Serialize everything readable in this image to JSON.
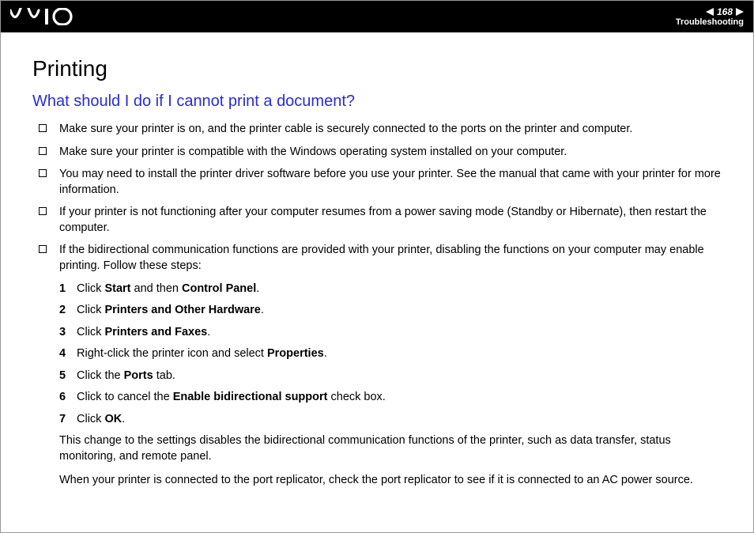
{
  "header": {
    "page_number": "168",
    "section": "Troubleshooting"
  },
  "title": "Printing",
  "subtitle": "What should I do if I cannot print a document?",
  "bullets": [
    "Make sure your printer is on, and the printer cable is securely connected to the ports on the printer and computer.",
    "Make sure your printer is compatible with the Windows operating system installed on your computer.",
    "You may need to install the printer driver software before you use your printer. See the manual that came with your printer for more information.",
    "If your printer is not functioning after your computer resumes from a power saving mode (Standby or Hibernate), then restart the computer.",
    "If the bidirectional communication functions are provided with your printer, disabling the functions on your computer may enable printing. Follow these steps:"
  ],
  "steps": [
    {
      "num": "1",
      "pre": "Click ",
      "b1": "Start",
      "mid": " and then ",
      "b2": "Control Panel",
      "post": "."
    },
    {
      "num": "2",
      "pre": "Click ",
      "b1": "Printers and Other Hardware",
      "mid": "",
      "b2": "",
      "post": "."
    },
    {
      "num": "3",
      "pre": "Click ",
      "b1": "Printers and Faxes",
      "mid": "",
      "b2": "",
      "post": "."
    },
    {
      "num": "4",
      "pre": "Right-click the printer icon and select ",
      "b1": "Properties",
      "mid": "",
      "b2": "",
      "post": "."
    },
    {
      "num": "5",
      "pre": "Click the ",
      "b1": "Ports",
      "mid": "",
      "b2": "",
      "post": " tab."
    },
    {
      "num": "6",
      "pre": "Click to cancel the ",
      "b1": "Enable bidirectional support",
      "mid": "",
      "b2": "",
      "post": " check box."
    },
    {
      "num": "7",
      "pre": "Click ",
      "b1": "OK",
      "mid": "",
      "b2": "",
      "post": "."
    }
  ],
  "closing": [
    "This change to the settings disables the bidirectional communication functions of the printer, such as data transfer, status monitoring, and remote panel.",
    "When your printer is connected to the port replicator, check the port replicator to see if it is connected to an AC power source."
  ]
}
